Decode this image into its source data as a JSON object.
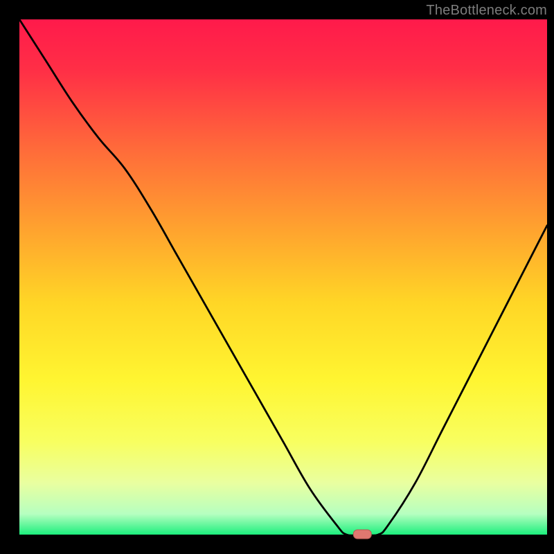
{
  "watermark": "TheBottleneck.com",
  "colors": {
    "bg_black": "#000000",
    "gradient_stops": [
      {
        "pct": 0,
        "color": "#ff1a4b"
      },
      {
        "pct": 10,
        "color": "#ff2f46"
      },
      {
        "pct": 25,
        "color": "#ff6a3a"
      },
      {
        "pct": 40,
        "color": "#ffa02f"
      },
      {
        "pct": 55,
        "color": "#ffd626"
      },
      {
        "pct": 70,
        "color": "#fff531"
      },
      {
        "pct": 82,
        "color": "#f8ff60"
      },
      {
        "pct": 90,
        "color": "#e9ffa0"
      },
      {
        "pct": 96,
        "color": "#b6ffc0"
      },
      {
        "pct": 100,
        "color": "#1cef7d"
      }
    ],
    "curve_stroke": "#000000",
    "marker_fill": "#e07870",
    "marker_stroke": "#b55a52"
  },
  "chart_data": {
    "type": "line",
    "title": "",
    "xlabel": "",
    "ylabel": "",
    "x": [
      0.0,
      0.05,
      0.1,
      0.15,
      0.2,
      0.25,
      0.3,
      0.35,
      0.4,
      0.45,
      0.5,
      0.55,
      0.6,
      0.62,
      0.65,
      0.68,
      0.7,
      0.75,
      0.8,
      0.85,
      0.9,
      0.95,
      1.0
    ],
    "values": [
      100,
      92,
      84,
      77,
      71,
      63,
      54,
      45,
      36,
      27,
      18,
      9,
      2,
      0,
      0,
      0,
      2,
      10,
      20,
      30,
      40,
      50,
      60
    ],
    "xlim": [
      0,
      1
    ],
    "ylim": [
      0,
      100
    ],
    "marker": {
      "x": 0.65,
      "y": 0
    }
  }
}
